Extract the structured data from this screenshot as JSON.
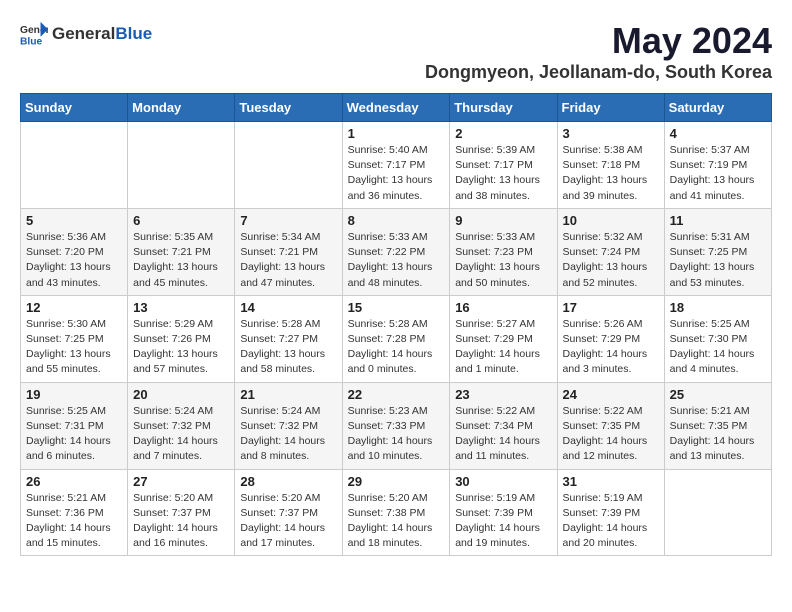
{
  "header": {
    "logo_general": "General",
    "logo_blue": "Blue",
    "month_title": "May 2024",
    "location": "Dongmyeon, Jeollanam-do, South Korea"
  },
  "weekdays": [
    "Sunday",
    "Monday",
    "Tuesday",
    "Wednesday",
    "Thursday",
    "Friday",
    "Saturday"
  ],
  "weeks": [
    [
      {
        "day": "",
        "info": ""
      },
      {
        "day": "",
        "info": ""
      },
      {
        "day": "",
        "info": ""
      },
      {
        "day": "1",
        "info": "Sunrise: 5:40 AM\nSunset: 7:17 PM\nDaylight: 13 hours\nand 36 minutes."
      },
      {
        "day": "2",
        "info": "Sunrise: 5:39 AM\nSunset: 7:17 PM\nDaylight: 13 hours\nand 38 minutes."
      },
      {
        "day": "3",
        "info": "Sunrise: 5:38 AM\nSunset: 7:18 PM\nDaylight: 13 hours\nand 39 minutes."
      },
      {
        "day": "4",
        "info": "Sunrise: 5:37 AM\nSunset: 7:19 PM\nDaylight: 13 hours\nand 41 minutes."
      }
    ],
    [
      {
        "day": "5",
        "info": "Sunrise: 5:36 AM\nSunset: 7:20 PM\nDaylight: 13 hours\nand 43 minutes."
      },
      {
        "day": "6",
        "info": "Sunrise: 5:35 AM\nSunset: 7:21 PM\nDaylight: 13 hours\nand 45 minutes."
      },
      {
        "day": "7",
        "info": "Sunrise: 5:34 AM\nSunset: 7:21 PM\nDaylight: 13 hours\nand 47 minutes."
      },
      {
        "day": "8",
        "info": "Sunrise: 5:33 AM\nSunset: 7:22 PM\nDaylight: 13 hours\nand 48 minutes."
      },
      {
        "day": "9",
        "info": "Sunrise: 5:33 AM\nSunset: 7:23 PM\nDaylight: 13 hours\nand 50 minutes."
      },
      {
        "day": "10",
        "info": "Sunrise: 5:32 AM\nSunset: 7:24 PM\nDaylight: 13 hours\nand 52 minutes."
      },
      {
        "day": "11",
        "info": "Sunrise: 5:31 AM\nSunset: 7:25 PM\nDaylight: 13 hours\nand 53 minutes."
      }
    ],
    [
      {
        "day": "12",
        "info": "Sunrise: 5:30 AM\nSunset: 7:25 PM\nDaylight: 13 hours\nand 55 minutes."
      },
      {
        "day": "13",
        "info": "Sunrise: 5:29 AM\nSunset: 7:26 PM\nDaylight: 13 hours\nand 57 minutes."
      },
      {
        "day": "14",
        "info": "Sunrise: 5:28 AM\nSunset: 7:27 PM\nDaylight: 13 hours\nand 58 minutes."
      },
      {
        "day": "15",
        "info": "Sunrise: 5:28 AM\nSunset: 7:28 PM\nDaylight: 14 hours\nand 0 minutes."
      },
      {
        "day": "16",
        "info": "Sunrise: 5:27 AM\nSunset: 7:29 PM\nDaylight: 14 hours\nand 1 minute."
      },
      {
        "day": "17",
        "info": "Sunrise: 5:26 AM\nSunset: 7:29 PM\nDaylight: 14 hours\nand 3 minutes."
      },
      {
        "day": "18",
        "info": "Sunrise: 5:25 AM\nSunset: 7:30 PM\nDaylight: 14 hours\nand 4 minutes."
      }
    ],
    [
      {
        "day": "19",
        "info": "Sunrise: 5:25 AM\nSunset: 7:31 PM\nDaylight: 14 hours\nand 6 minutes."
      },
      {
        "day": "20",
        "info": "Sunrise: 5:24 AM\nSunset: 7:32 PM\nDaylight: 14 hours\nand 7 minutes."
      },
      {
        "day": "21",
        "info": "Sunrise: 5:24 AM\nSunset: 7:32 PM\nDaylight: 14 hours\nand 8 minutes."
      },
      {
        "day": "22",
        "info": "Sunrise: 5:23 AM\nSunset: 7:33 PM\nDaylight: 14 hours\nand 10 minutes."
      },
      {
        "day": "23",
        "info": "Sunrise: 5:22 AM\nSunset: 7:34 PM\nDaylight: 14 hours\nand 11 minutes."
      },
      {
        "day": "24",
        "info": "Sunrise: 5:22 AM\nSunset: 7:35 PM\nDaylight: 14 hours\nand 12 minutes."
      },
      {
        "day": "25",
        "info": "Sunrise: 5:21 AM\nSunset: 7:35 PM\nDaylight: 14 hours\nand 13 minutes."
      }
    ],
    [
      {
        "day": "26",
        "info": "Sunrise: 5:21 AM\nSunset: 7:36 PM\nDaylight: 14 hours\nand 15 minutes."
      },
      {
        "day": "27",
        "info": "Sunrise: 5:20 AM\nSunset: 7:37 PM\nDaylight: 14 hours\nand 16 minutes."
      },
      {
        "day": "28",
        "info": "Sunrise: 5:20 AM\nSunset: 7:37 PM\nDaylight: 14 hours\nand 17 minutes."
      },
      {
        "day": "29",
        "info": "Sunrise: 5:20 AM\nSunset: 7:38 PM\nDaylight: 14 hours\nand 18 minutes."
      },
      {
        "day": "30",
        "info": "Sunrise: 5:19 AM\nSunset: 7:39 PM\nDaylight: 14 hours\nand 19 minutes."
      },
      {
        "day": "31",
        "info": "Sunrise: 5:19 AM\nSunset: 7:39 PM\nDaylight: 14 hours\nand 20 minutes."
      },
      {
        "day": "",
        "info": ""
      }
    ]
  ]
}
